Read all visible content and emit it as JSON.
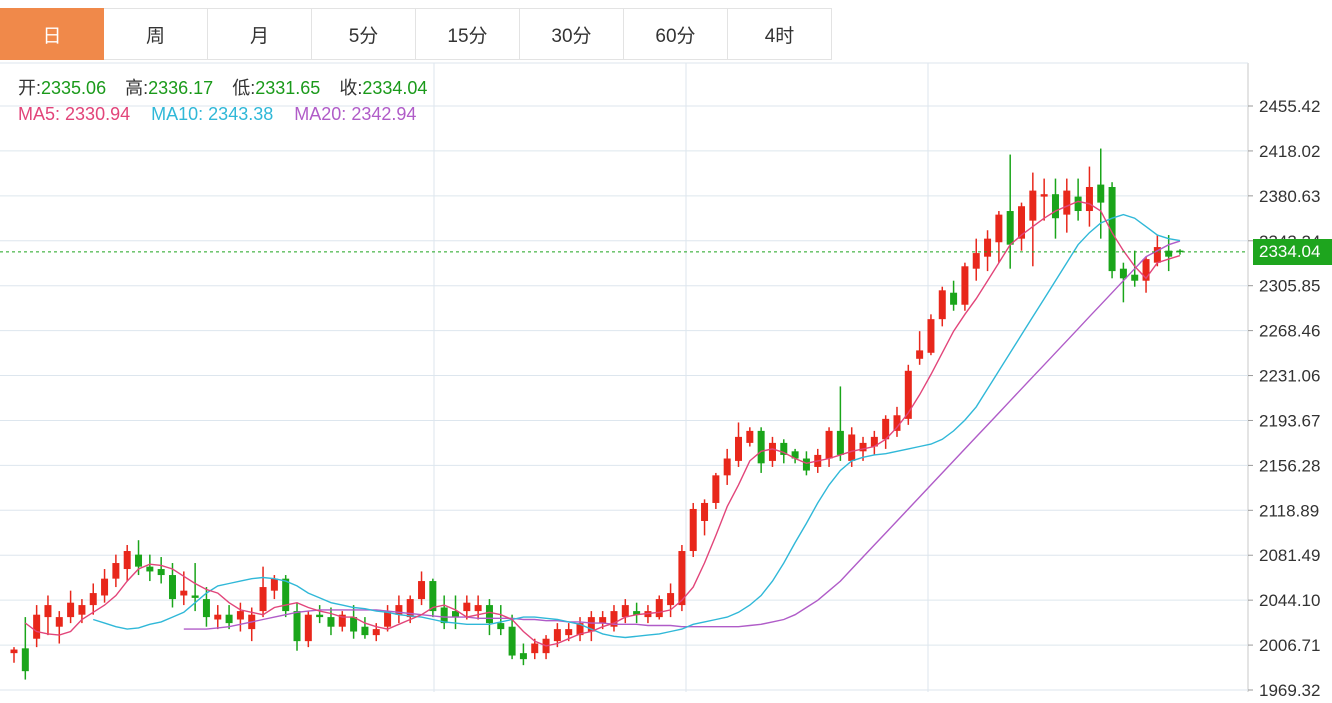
{
  "tabs": [
    "日",
    "周",
    "月",
    "5分",
    "15分",
    "30分",
    "60分",
    "4时"
  ],
  "active_tab": 0,
  "ohlc_info": {
    "open_label": "开:",
    "open": "2335.06",
    "high_label": "高:",
    "high": "2336.17",
    "low_label": "低:",
    "low": "2331.65",
    "close_label": "收:",
    "close": "2334.04"
  },
  "ma_info": {
    "ma5_label": "MA5:",
    "ma5": "2330.94",
    "ma10_label": "MA10:",
    "ma10": "2343.38",
    "ma20_label": "MA20:",
    "ma20": "2342.94"
  },
  "last_price": "2334.04",
  "colors": {
    "up": "#e8271b",
    "down": "#1aa51a",
    "ma5": "#e2457a",
    "ma10": "#30b8d8",
    "ma20": "#b05cc8",
    "active_tab": "#f0894a"
  },
  "chart_data": {
    "type": "candlestick",
    "y_ticks": [
      "2455.42",
      "2418.02",
      "2380.63",
      "2343.24",
      "2305.85",
      "2268.46",
      "2231.06",
      "2193.67",
      "2156.28",
      "2118.89",
      "2081.49",
      "2044.10",
      "2006.71",
      "1969.32"
    ],
    "ylim": [
      1963,
      2470
    ],
    "grid": true,
    "last_price": 2334.04,
    "candles": [
      [
        2000,
        2005,
        1992,
        2003
      ],
      [
        2004,
        2030,
        1978,
        1985
      ],
      [
        2012,
        2040,
        2005,
        2032
      ],
      [
        2030,
        2048,
        2015,
        2040
      ],
      [
        2022,
        2035,
        2008,
        2030
      ],
      [
        2030,
        2052,
        2025,
        2042
      ],
      [
        2032,
        2045,
        2025,
        2040
      ],
      [
        2040,
        2058,
        2032,
        2050
      ],
      [
        2048,
        2070,
        2042,
        2062
      ],
      [
        2062,
        2082,
        2055,
        2075
      ],
      [
        2070,
        2090,
        2060,
        2085
      ],
      [
        2082,
        2094,
        2065,
        2072
      ],
      [
        2072,
        2082,
        2060,
        2068
      ],
      [
        2070,
        2080,
        2058,
        2065
      ],
      [
        2065,
        2075,
        2038,
        2045
      ],
      [
        2048,
        2068,
        2040,
        2052
      ],
      [
        2048,
        2075,
        2035,
        2046
      ],
      [
        2045,
        2055,
        2022,
        2030
      ],
      [
        2028,
        2040,
        2020,
        2032
      ],
      [
        2032,
        2040,
        2020,
        2025
      ],
      [
        2028,
        2042,
        2018,
        2035
      ],
      [
        2020,
        2038,
        2010,
        2032
      ],
      [
        2035,
        2072,
        2030,
        2055
      ],
      [
        2052,
        2065,
        2045,
        2062
      ],
      [
        2062,
        2065,
        2030,
        2035
      ],
      [
        2035,
        2042,
        2002,
        2010
      ],
      [
        2010,
        2035,
        2005,
        2032
      ],
      [
        2032,
        2040,
        2025,
        2030
      ],
      [
        2030,
        2038,
        2015,
        2022
      ],
      [
        2022,
        2035,
        2018,
        2032
      ],
      [
        2030,
        2040,
        2012,
        2018
      ],
      [
        2022,
        2030,
        2012,
        2015
      ],
      [
        2015,
        2025,
        2010,
        2020
      ],
      [
        2022,
        2040,
        2018,
        2035
      ],
      [
        2032,
        2048,
        2025,
        2040
      ],
      [
        2030,
        2048,
        2025,
        2045
      ],
      [
        2045,
        2068,
        2040,
        2060
      ],
      [
        2060,
        2062,
        2030,
        2035
      ],
      [
        2038,
        2048,
        2020,
        2025
      ],
      [
        2035,
        2048,
        2020,
        2030
      ],
      [
        2035,
        2048,
        2028,
        2042
      ],
      [
        2035,
        2048,
        2028,
        2040
      ],
      [
        2040,
        2045,
        2015,
        2025
      ],
      [
        2025,
        2040,
        2015,
        2020
      ],
      [
        2022,
        2032,
        1995,
        1998
      ],
      [
        2000,
        2008,
        1990,
        1995
      ],
      [
        2000,
        2012,
        1995,
        2008
      ],
      [
        2000,
        2015,
        1995,
        2012
      ],
      [
        2010,
        2025,
        2005,
        2020
      ],
      [
        2015,
        2025,
        2010,
        2020
      ],
      [
        2015,
        2030,
        2010,
        2025
      ],
      [
        2018,
        2035,
        2010,
        2030
      ],
      [
        2025,
        2035,
        2020,
        2030
      ],
      [
        2022,
        2040,
        2018,
        2035
      ],
      [
        2030,
        2045,
        2025,
        2040
      ],
      [
        2035,
        2042,
        2025,
        2032
      ],
      [
        2030,
        2040,
        2025,
        2035
      ],
      [
        2030,
        2048,
        2028,
        2045
      ],
      [
        2040,
        2058,
        2030,
        2050
      ],
      [
        2040,
        2090,
        2035,
        2085
      ],
      [
        2085,
        2125,
        2080,
        2120
      ],
      [
        2110,
        2128,
        2098,
        2125
      ],
      [
        2125,
        2150,
        2120,
        2148
      ],
      [
        2148,
        2170,
        2140,
        2162
      ],
      [
        2160,
        2192,
        2155,
        2180
      ],
      [
        2175,
        2188,
        2172,
        2185
      ],
      [
        2185,
        2188,
        2150,
        2158
      ],
      [
        2160,
        2180,
        2155,
        2175
      ],
      [
        2175,
        2178,
        2158,
        2165
      ],
      [
        2168,
        2170,
        2158,
        2162
      ],
      [
        2162,
        2168,
        2148,
        2152
      ],
      [
        2155,
        2170,
        2150,
        2165
      ],
      [
        2162,
        2188,
        2155,
        2185
      ],
      [
        2185,
        2222,
        2160,
        2165
      ],
      [
        2160,
        2188,
        2155,
        2182
      ],
      [
        2168,
        2180,
        2160,
        2175
      ],
      [
        2172,
        2185,
        2165,
        2180
      ],
      [
        2178,
        2198,
        2170,
        2195
      ],
      [
        2185,
        2205,
        2180,
        2198
      ],
      [
        2195,
        2240,
        2190,
        2235
      ],
      [
        2245,
        2268,
        2240,
        2252
      ],
      [
        2250,
        2282,
        2248,
        2278
      ],
      [
        2278,
        2305,
        2272,
        2302
      ],
      [
        2300,
        2310,
        2285,
        2290
      ],
      [
        2290,
        2325,
        2285,
        2322
      ],
      [
        2320,
        2345,
        2310,
        2333
      ],
      [
        2330,
        2352,
        2318,
        2345
      ],
      [
        2342,
        2368,
        2325,
        2365
      ],
      [
        2368,
        2415,
        2320,
        2340
      ],
      [
        2345,
        2375,
        2335,
        2372
      ],
      [
        2360,
        2400,
        2322,
        2385
      ],
      [
        2380,
        2395,
        2360,
        2382
      ],
      [
        2382,
        2395,
        2345,
        2362
      ],
      [
        2365,
        2395,
        2350,
        2385
      ],
      [
        2380,
        2395,
        2360,
        2368
      ],
      [
        2368,
        2405,
        2355,
        2388
      ],
      [
        2390,
        2420,
        2345,
        2375
      ],
      [
        2388,
        2392,
        2312,
        2318
      ],
      [
        2320,
        2325,
        2292,
        2312
      ],
      [
        2315,
        2335,
        2305,
        2310
      ],
      [
        2310,
        2330,
        2300,
        2328
      ],
      [
        2325,
        2348,
        2322,
        2338
      ],
      [
        2335,
        2348,
        2318,
        2330
      ],
      [
        2335.06,
        2336.17,
        2331.65,
        2334.04
      ]
    ],
    "ma5": [
      2025,
      2018,
      2016,
      2015,
      2018,
      2028,
      2034,
      2040,
      2048,
      2060,
      2070,
      2074,
      2073,
      2070,
      2064,
      2058,
      2053,
      2050,
      2042,
      2036,
      2034,
      2032,
      2038,
      2040,
      2042,
      2038,
      2035,
      2033,
      2030,
      2030,
      2025,
      2022,
      2020,
      2024,
      2028,
      2032,
      2038,
      2040,
      2036,
      2030,
      2032,
      2034,
      2032,
      2028,
      2018,
      2010,
      2006,
      2008,
      2012,
      2016,
      2018,
      2022,
      2025,
      2030,
      2032,
      2033,
      2034,
      2036,
      2044,
      2055,
      2075,
      2098,
      2122,
      2140,
      2160,
      2168,
      2170,
      2167,
      2162,
      2158,
      2160,
      2162,
      2165,
      2168,
      2170,
      2172,
      2178,
      2188,
      2200,
      2215,
      2232,
      2250,
      2268,
      2282,
      2295,
      2310,
      2325,
      2340,
      2348,
      2355,
      2362,
      2368,
      2372,
      2376,
      2374,
      2368,
      2350,
      2335,
      2322,
      2312,
      2325,
      2328,
      2330.94
    ],
    "ma10": [
      2028,
      2025,
      2022,
      2020,
      2021,
      2024,
      2026,
      2030,
      2034,
      2042,
      2050,
      2056,
      2058,
      2060,
      2062,
      2063,
      2062,
      2060,
      2056,
      2050,
      2046,
      2042,
      2040,
      2038,
      2037,
      2035,
      2034,
      2032,
      2031,
      2030,
      2028,
      2026,
      2025,
      2024,
      2024,
      2024,
      2026,
      2028,
      2030,
      2030,
      2029,
      2028,
      2026,
      2024,
      2020,
      2016,
      2014,
      2013,
      2014,
      2015,
      2016,
      2018,
      2020,
      2024,
      2026,
      2028,
      2030,
      2034,
      2040,
      2048,
      2060,
      2075,
      2092,
      2108,
      2125,
      2140,
      2152,
      2160,
      2163,
      2165,
      2166,
      2168,
      2170,
      2172,
      2174,
      2178,
      2185,
      2194,
      2205,
      2220,
      2235,
      2250,
      2265,
      2280,
      2295,
      2310,
      2325,
      2340,
      2350,
      2358,
      2362,
      2365,
      2362,
      2355,
      2348,
      2345,
      2343.38
    ],
    "ma20": [
      2020,
      2020,
      2020,
      2021,
      2022,
      2024,
      2026,
      2028,
      2030,
      2032,
      2034,
      2035,
      2036,
      2036,
      2036,
      2036,
      2036,
      2036,
      2035,
      2034,
      2033,
      2032,
      2031,
      2030,
      2030,
      2030,
      2029,
      2029,
      2029,
      2029,
      2028,
      2028,
      2027,
      2027,
      2026,
      2026,
      2025,
      2025,
      2024,
      2024,
      2024,
      2023,
      2023,
      2023,
      2022,
      2022,
      2022,
      2022,
      2022,
      2022,
      2023,
      2024,
      2026,
      2028,
      2032,
      2038,
      2044,
      2052,
      2060,
      2070,
      2080,
      2090,
      2100,
      2110,
      2120,
      2130,
      2140,
      2150,
      2160,
      2170,
      2180,
      2190,
      2200,
      2210,
      2220,
      2230,
      2240,
      2250,
      2260,
      2270,
      2280,
      2290,
      2300,
      2310,
      2320,
      2330,
      2335,
      2340,
      2342.94
    ]
  }
}
